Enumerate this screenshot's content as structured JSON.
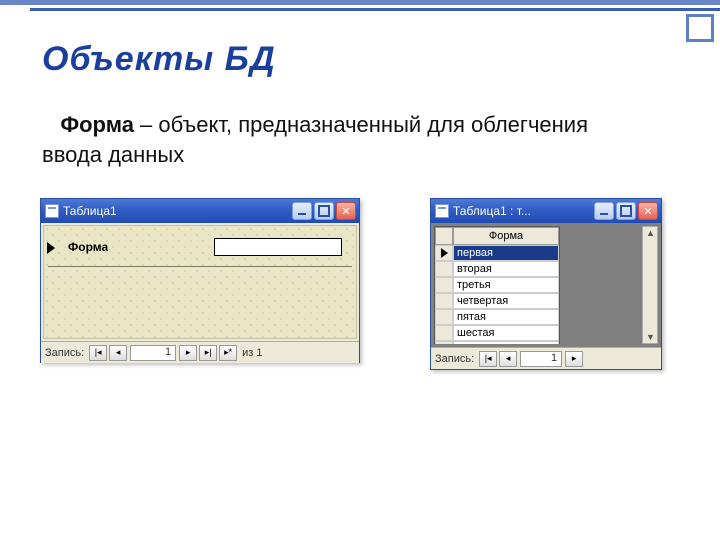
{
  "slide": {
    "title": "Объекты БД",
    "term": "Форма",
    "definition": " – объект, предназначенный для облегчения ввода данных"
  },
  "window1": {
    "title": "Таблица1",
    "label": "Форма",
    "value": "",
    "nav": {
      "label": "Запись:",
      "current": "1",
      "total": "из 1"
    }
  },
  "window2": {
    "title": "Таблица1 : т...",
    "column": "Форма",
    "rows": [
      "первая",
      "вторая",
      "третья",
      "четвертая",
      "пятая",
      "шестая"
    ],
    "new_marker": "*",
    "nav": {
      "label": "Запись:",
      "current": "1"
    }
  }
}
